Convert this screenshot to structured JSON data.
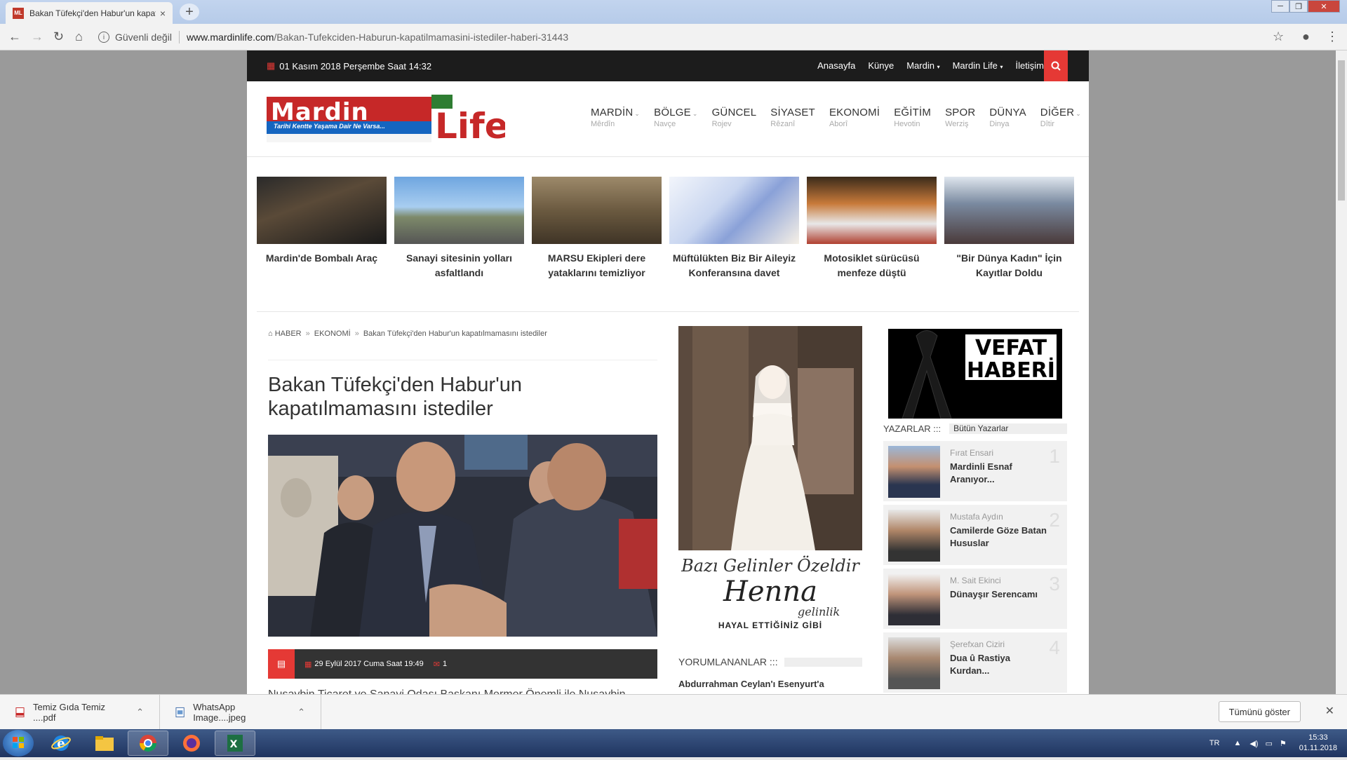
{
  "browser": {
    "tab_title": "Bakan Tüfekçi'den Habur'un kapatılmamasını istediler",
    "tab_close": "×",
    "new_tab": "+",
    "security_label": "Güvenli değil",
    "url_host": "www.mardinlife.com",
    "url_path": "/Bakan-Tufekciden-Haburun-kapatilmamasini-istediler-haberi-31443"
  },
  "site": {
    "date_label": "01 Kasım 2018 Perşembe Saat 14:32",
    "top_links": [
      "Anasayfa",
      "Künye",
      "Mardin",
      "Mardin Life",
      "İletişim"
    ],
    "logo_text": "Mardin Life",
    "logo_tagline": "Tarihi Kentte Yaşama Dair Ne Varsa...",
    "nav": [
      {
        "label": "MARDİN",
        "sub": "Mêrdîn",
        "has_dropdown": true
      },
      {
        "label": "BÖLGE",
        "sub": "Navçe",
        "has_dropdown": true
      },
      {
        "label": "GÜNCEL",
        "sub": "Rojev",
        "has_dropdown": false
      },
      {
        "label": "SİYASET",
        "sub": "Rêzanî",
        "has_dropdown": false
      },
      {
        "label": "EKONOMİ",
        "sub": "Aborî",
        "has_dropdown": false
      },
      {
        "label": "EĞİTİM",
        "sub": "Hevotin",
        "has_dropdown": false
      },
      {
        "label": "SPOR",
        "sub": "Werziş",
        "has_dropdown": false
      },
      {
        "label": "DÜNYA",
        "sub": "Dinya",
        "has_dropdown": false
      },
      {
        "label": "DİĞER",
        "sub": "Dîtir",
        "has_dropdown": true
      }
    ],
    "featured": [
      {
        "caption": "Mardin'de Bombalı Araç"
      },
      {
        "caption": "Sanayi sitesinin yolları asfaltlandı"
      },
      {
        "caption": "MARSU Ekipleri dere yataklarını temizliyor"
      },
      {
        "caption": "Müftülükten Biz Bir Aileyiz Konferansına davet"
      },
      {
        "caption": "Motosiklet sürücüsü menfeze düştü"
      },
      {
        "caption": "\"Bir Dünya Kadın\" İçin Kayıtlar Doldu"
      }
    ],
    "breadcrumb": [
      "HABER",
      "EKONOMİ",
      "Bakan Tüfekçi'den Habur'un kapatılmamasını istediler"
    ],
    "article": {
      "title": "Bakan Tüfekçi'den Habur'un kapatılmamasını istediler",
      "date": "29 Eylül 2017 Cuma Saat 19:49",
      "comments": "1",
      "body_start": "Nusaybin Ticaret ve Sanayi Odası Başkanı Mermer Önemli ile Nusaybin"
    },
    "ad": {
      "line1": "Bazı Gelinler Özeldir",
      "brand": "Henna",
      "brand_sub": "gelinlik",
      "tagline": "HAYAL ETTİĞİNİZ GİBİ"
    },
    "commented": {
      "label": "YORUMLANANLAR :::",
      "items": [
        "Abdurrahman Ceylan'ı Esenyurt'a"
      ]
    },
    "vefat": {
      "line1": "VEFAT",
      "line2": "HABERİ"
    },
    "authors": {
      "label": "YAZARLAR :::",
      "all_label": "Bütün Yazarlar",
      "items": [
        {
          "rank": "1",
          "name": "Fırat Ensari",
          "title": "Mardinli Esnaf Aranıyor..."
        },
        {
          "rank": "2",
          "name": "Mustafa Aydın",
          "title": "Camilerde Göze Batan Hususlar"
        },
        {
          "rank": "3",
          "name": "M. Sait Ekinci",
          "title": "Dünayşır Serencamı"
        },
        {
          "rank": "4",
          "name": "Şerefxan Ciziri",
          "title": "Dua û Rastiya Kurdan..."
        }
      ]
    }
  },
  "downloads": {
    "items": [
      "Temiz Gıda Temiz ....pdf",
      "WhatsApp Image....jpeg"
    ],
    "show_all": "Tümünü göster"
  },
  "taskbar": {
    "lang": "TR",
    "time": "15:33",
    "date": "01.11.2018"
  },
  "colors": {
    "accent": "#e53935",
    "top_strip": "#1c1c1c",
    "meta_bar": "#333333"
  }
}
